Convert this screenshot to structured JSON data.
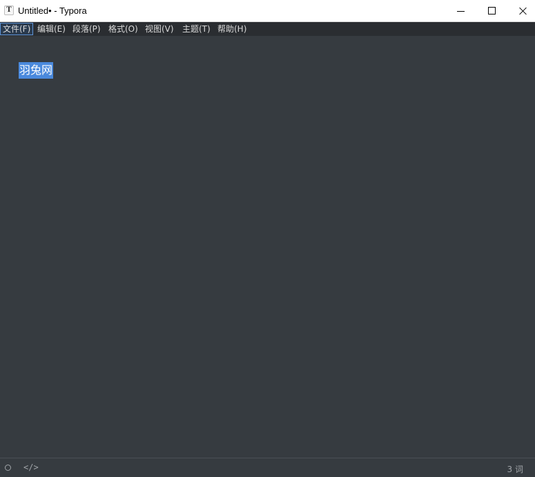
{
  "window": {
    "title": "Untitled• - Typora",
    "app_icon_letter": "T"
  },
  "menu": [
    {
      "label": "文件(F)"
    },
    {
      "label": "编辑(E)"
    },
    {
      "label": "段落(P)"
    },
    {
      "label": "格式(O)"
    },
    {
      "label": "视图(V)"
    },
    {
      "label": "主题(T)"
    },
    {
      "label": "帮助(H)"
    }
  ],
  "editor": {
    "selected_text": "羽兔网"
  },
  "statusbar": {
    "outline_icon": "circle-icon",
    "source_icon": "</>",
    "word_count": "3 词"
  },
  "colors": {
    "editor_bg": "#363b40",
    "menubar_bg": "#2a2d31",
    "selection": "#4a89dc"
  }
}
